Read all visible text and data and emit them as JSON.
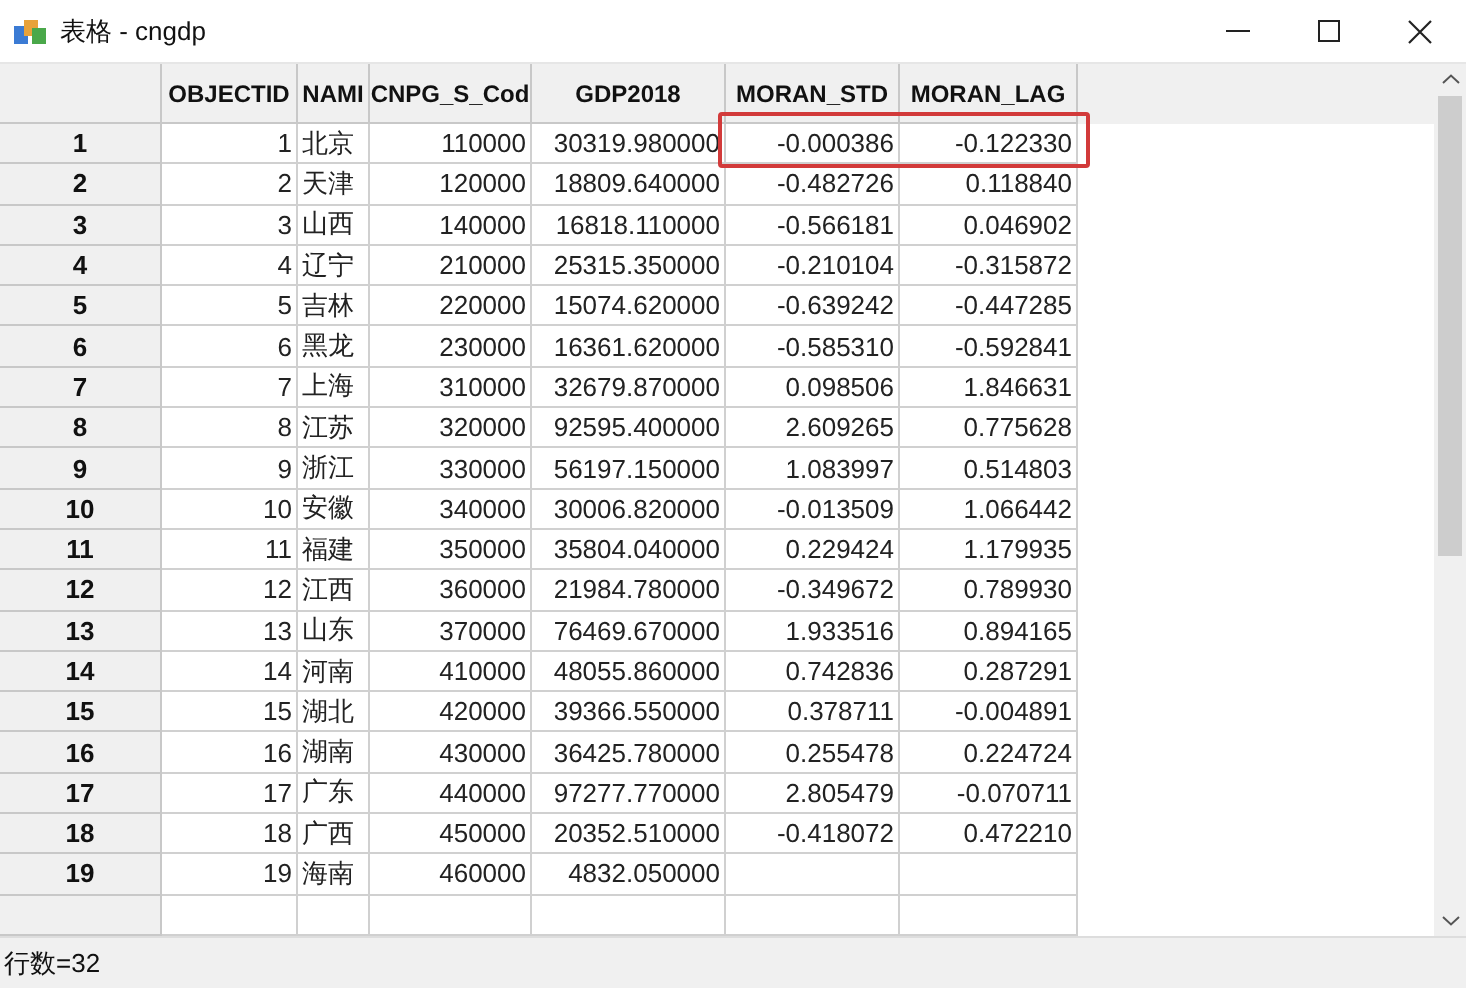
{
  "window": {
    "title": "表格 - cngdp"
  },
  "table": {
    "columns": [
      "OBJECTID",
      "NAMI",
      "CNPG_S_Cod",
      "GDP2018",
      "MORAN_STD",
      "MORAN_LAG"
    ],
    "rows": [
      {
        "row_header": "1",
        "cells": [
          "1",
          "北京",
          "110000",
          "30319.980000",
          "-0.000386",
          "-0.122330"
        ]
      },
      {
        "row_header": "2",
        "cells": [
          "2",
          "天津",
          "120000",
          "18809.640000",
          "-0.482726",
          "0.118840"
        ]
      },
      {
        "row_header": "3",
        "cells": [
          "3",
          "山西",
          "140000",
          "16818.110000",
          "-0.566181",
          "0.046902"
        ]
      },
      {
        "row_header": "4",
        "cells": [
          "4",
          "辽宁",
          "210000",
          "25315.350000",
          "-0.210104",
          "-0.315872"
        ]
      },
      {
        "row_header": "5",
        "cells": [
          "5",
          "吉林",
          "220000",
          "15074.620000",
          "-0.639242",
          "-0.447285"
        ]
      },
      {
        "row_header": "6",
        "cells": [
          "6",
          "黑龙",
          "230000",
          "16361.620000",
          "-0.585310",
          "-0.592841"
        ]
      },
      {
        "row_header": "7",
        "cells": [
          "7",
          "上海",
          "310000",
          "32679.870000",
          "0.098506",
          "1.846631"
        ]
      },
      {
        "row_header": "8",
        "cells": [
          "8",
          "江苏",
          "320000",
          "92595.400000",
          "2.609265",
          "0.775628"
        ]
      },
      {
        "row_header": "9",
        "cells": [
          "9",
          "浙江",
          "330000",
          "56197.150000",
          "1.083997",
          "0.514803"
        ]
      },
      {
        "row_header": "10",
        "cells": [
          "10",
          "安徽",
          "340000",
          "30006.820000",
          "-0.013509",
          "1.066442"
        ]
      },
      {
        "row_header": "11",
        "cells": [
          "11",
          "福建",
          "350000",
          "35804.040000",
          "0.229424",
          "1.179935"
        ]
      },
      {
        "row_header": "12",
        "cells": [
          "12",
          "江西",
          "360000",
          "21984.780000",
          "-0.349672",
          "0.789930"
        ]
      },
      {
        "row_header": "13",
        "cells": [
          "13",
          "山东",
          "370000",
          "76469.670000",
          "1.933516",
          "0.894165"
        ]
      },
      {
        "row_header": "14",
        "cells": [
          "14",
          "河南",
          "410000",
          "48055.860000",
          "0.742836",
          "0.287291"
        ]
      },
      {
        "row_header": "15",
        "cells": [
          "15",
          "湖北",
          "420000",
          "39366.550000",
          "0.378711",
          "-0.004891"
        ]
      },
      {
        "row_header": "16",
        "cells": [
          "16",
          "湖南",
          "430000",
          "36425.780000",
          "0.255478",
          "0.224724"
        ]
      },
      {
        "row_header": "17",
        "cells": [
          "17",
          "广东",
          "440000",
          "97277.770000",
          "2.805479",
          "-0.070711"
        ]
      },
      {
        "row_header": "18",
        "cells": [
          "18",
          "广西",
          "450000",
          "20352.510000",
          "-0.418072",
          "0.472210"
        ]
      },
      {
        "row_header": "19",
        "cells": [
          "19",
          "海南",
          "460000",
          "4832.050000"
        ]
      }
    ]
  },
  "status_bar": {
    "text": "行数=32"
  }
}
